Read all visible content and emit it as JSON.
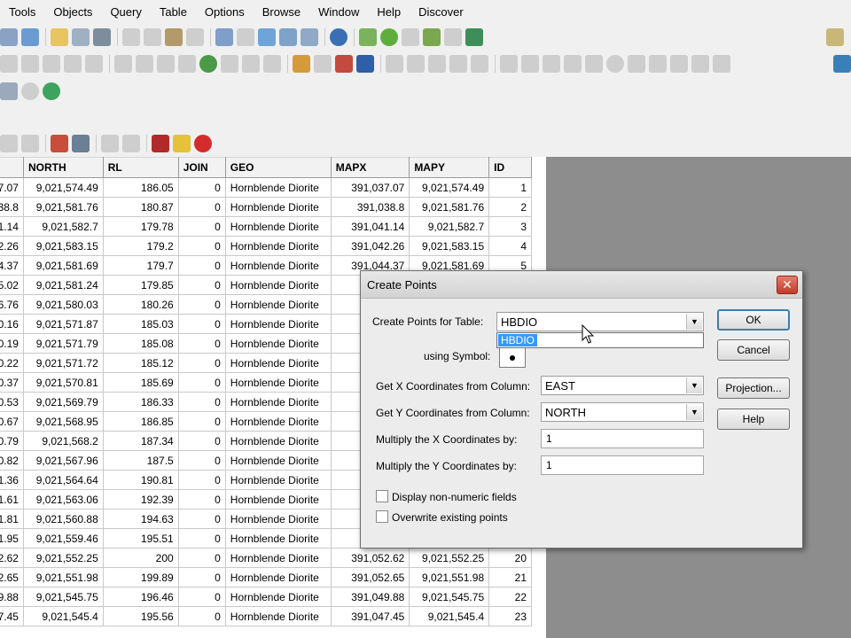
{
  "menubar": [
    "Tools",
    "Objects",
    "Query",
    "Table",
    "Options",
    "Browse",
    "Window",
    "Help",
    "Discover"
  ],
  "table": {
    "columns": [
      "",
      "NORTH",
      "RL",
      "JOIN",
      "GEO",
      "MAPX",
      "MAPY",
      "ID"
    ],
    "rows": [
      [
        "7.07",
        "9,021,574.49",
        "186.05",
        "0",
        "Hornblende Diorite",
        "391,037.07",
        "9,021,574.49",
        "1"
      ],
      [
        "38.8",
        "9,021,581.76",
        "180.87",
        "0",
        "Hornblende Diorite",
        "391,038.8",
        "9,021,581.76",
        "2"
      ],
      [
        "1.14",
        "9,021,582.7",
        "179.78",
        "0",
        "Hornblende Diorite",
        "391,041.14",
        "9,021,582.7",
        "3"
      ],
      [
        "2.26",
        "9,021,583.15",
        "179.2",
        "0",
        "Hornblende Diorite",
        "391,042.26",
        "9,021,583.15",
        "4"
      ],
      [
        "4.37",
        "9,021,581.69",
        "179.7",
        "0",
        "Hornblende Diorite",
        "391,044.37",
        "9,021,581.69",
        "5"
      ],
      [
        "5.02",
        "9,021,581.24",
        "179.85",
        "0",
        "Hornblende Diorite",
        "",
        "",
        ""
      ],
      [
        "6.76",
        "9,021,580.03",
        "180.26",
        "0",
        "Hornblende Diorite",
        "",
        "",
        ""
      ],
      [
        "0.16",
        "9,021,571.87",
        "185.03",
        "0",
        "Hornblende Diorite",
        "",
        "",
        ""
      ],
      [
        "0.19",
        "9,021,571.79",
        "185.08",
        "0",
        "Hornblende Diorite",
        "",
        "",
        ""
      ],
      [
        "0.22",
        "9,021,571.72",
        "185.12",
        "0",
        "Hornblende Diorite",
        "",
        "",
        ""
      ],
      [
        "0.37",
        "9,021,570.81",
        "185.69",
        "0",
        "Hornblende Diorite",
        "",
        "",
        ""
      ],
      [
        "0.53",
        "9,021,569.79",
        "186.33",
        "0",
        "Hornblende Diorite",
        "",
        "",
        ""
      ],
      [
        "0.67",
        "9,021,568.95",
        "186.85",
        "0",
        "Hornblende Diorite",
        "",
        "",
        ""
      ],
      [
        "0.79",
        "9,021,568.2",
        "187.34",
        "0",
        "Hornblende Diorite",
        "",
        "",
        ""
      ],
      [
        "0.82",
        "9,021,567.96",
        "187.5",
        "0",
        "Hornblende Diorite",
        "",
        "",
        ""
      ],
      [
        "1.36",
        "9,021,564.64",
        "190.81",
        "0",
        "Hornblende Diorite",
        "",
        "",
        ""
      ],
      [
        "1.61",
        "9,021,563.06",
        "192.39",
        "0",
        "Hornblende Diorite",
        "",
        "",
        ""
      ],
      [
        "1.81",
        "9,021,560.88",
        "194.63",
        "0",
        "Hornblende Diorite",
        "",
        "",
        ""
      ],
      [
        "1.95",
        "9,021,559.46",
        "195.51",
        "0",
        "Hornblende Diorite",
        "",
        "",
        ""
      ],
      [
        "2.62",
        "9,021,552.25",
        "200",
        "0",
        "Hornblende Diorite",
        "391,052.62",
        "9,021,552.25",
        "20"
      ],
      [
        "2.65",
        "9,021,551.98",
        "199.89",
        "0",
        "Hornblende Diorite",
        "391,052.65",
        "9,021,551.98",
        "21"
      ],
      [
        "9.88",
        "9,021,545.75",
        "196.46",
        "0",
        "Hornblende Diorite",
        "391,049.88",
        "9,021,545.75",
        "22"
      ],
      [
        "7.45",
        "9,021,545.4",
        "195.56",
        "0",
        "Hornblende Diorite",
        "391,047.45",
        "9,021,545.4",
        "23"
      ]
    ]
  },
  "dialog": {
    "title": "Create Points",
    "close_label": "✕",
    "table_label": "Create Points for Table:",
    "table_value": "HBDIO",
    "dropdown_option": "HBDIO",
    "symbol_label": "using Symbol:",
    "x_label": "Get X Coordinates from Column:",
    "x_value": "EAST",
    "y_label": "Get Y Coordinates from Column:",
    "y_value": "NORTH",
    "mult_x_label": "Multiply the X Coordinates by:",
    "mult_x_value": "1",
    "mult_y_label": "Multiply the Y Coordinates by:",
    "mult_y_value": "1",
    "chk_nonnumeric_label": "Display non-numeric fields",
    "chk_overwrite_label": "Overwrite existing points",
    "ok_label": "OK",
    "cancel_label": "Cancel",
    "projection_label": "Projection...",
    "help_label": "Help"
  },
  "colors": {
    "workspace": "#8d8d8d",
    "highlight": "#3399ff"
  }
}
